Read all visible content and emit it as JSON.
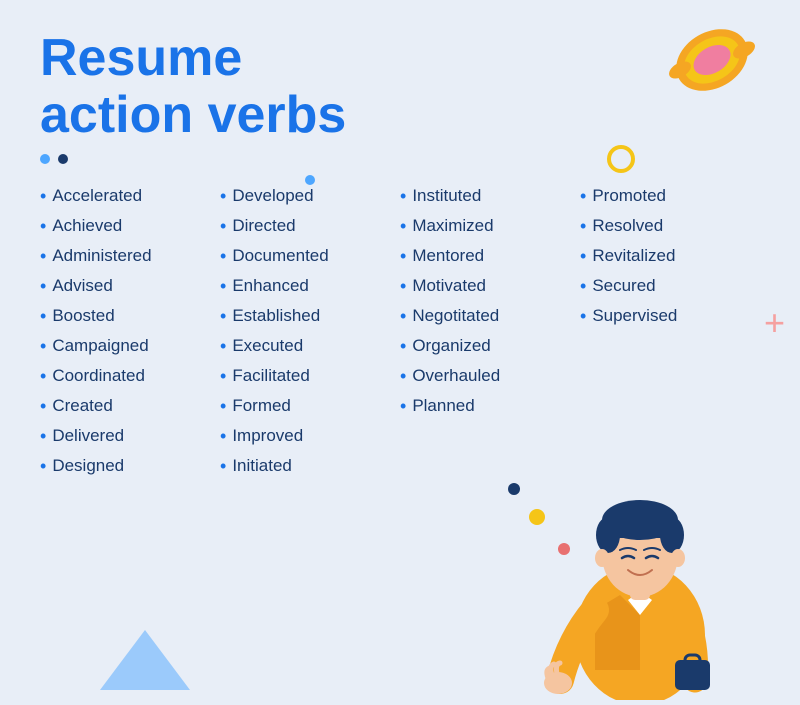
{
  "title": {
    "line1": "Resume",
    "line2": "action verbs"
  },
  "columns": [
    {
      "id": "col1",
      "items": [
        "Accelerated",
        "Achieved",
        "Administered",
        "Advised",
        "Boosted",
        "Campaigned",
        "Coordinated",
        "Created",
        "Delivered",
        "Designed"
      ]
    },
    {
      "id": "col2",
      "items": [
        "Developed",
        "Directed",
        "Documented",
        "Enhanced",
        "Established",
        "Executed",
        "Facilitated",
        "Formed",
        "Improved",
        "Initiated"
      ]
    },
    {
      "id": "col3",
      "items": [
        "Instituted",
        "Maximized",
        "Mentored",
        "Motivated",
        "Negotitated",
        "Organized",
        "Overhauled",
        "Planned"
      ]
    },
    {
      "id": "col4",
      "items": [
        "Promoted",
        "Resolved",
        "Revitalized",
        "Secured",
        "Supervised"
      ]
    }
  ],
  "decorations": {
    "dot1": "blue-light",
    "dot2": "blue-dark"
  }
}
